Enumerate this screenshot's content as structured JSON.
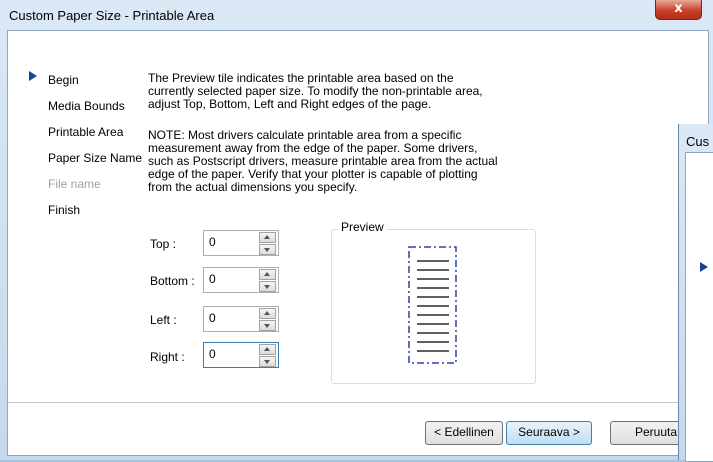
{
  "window": {
    "title": "Custom Paper Size - Printable Area",
    "close_symbol": "x"
  },
  "steps": {
    "items": [
      {
        "label": "Begin",
        "active": false,
        "disabled": false
      },
      {
        "label": "Media Bounds",
        "active": false,
        "disabled": false
      },
      {
        "label": "Printable Area",
        "active": true,
        "disabled": false
      },
      {
        "label": "Paper Size Name",
        "active": false,
        "disabled": false
      },
      {
        "label": "File name",
        "active": false,
        "disabled": true
      },
      {
        "label": "Finish",
        "active": false,
        "disabled": false
      }
    ]
  },
  "description": {
    "lines1": [
      "The Preview tile indicates the printable area based on the",
      "currently selected paper size. To modify the non-printable area,",
      "adjust Top, Bottom, Left and Right edges of the page."
    ],
    "lines2": [
      "NOTE: Most drivers calculate printable area from a specific",
      "measurement away from the edge of the paper. Some drivers,",
      "such as Postscript drivers, measure printable area from the actual",
      "edge of the paper. Verify that your plotter is capable of plotting",
      "from the actual dimensions you specify."
    ]
  },
  "fields": {
    "top": {
      "label": "Top :",
      "value": "0"
    },
    "bottom": {
      "label": "Bottom :",
      "value": "0"
    },
    "left": {
      "label": "Left :",
      "value": "0"
    },
    "right": {
      "label": "Right :",
      "value": "0"
    }
  },
  "preview": {
    "caption": "Preview"
  },
  "buttons": {
    "back": "< Edellinen",
    "next": "Seuraava >",
    "cancel": "Peruuta"
  },
  "background_window": {
    "title_fragment": "Cus"
  },
  "colors": {
    "accent_arrow": "#1a3f9c",
    "paper_border": "#0b1fa3"
  }
}
